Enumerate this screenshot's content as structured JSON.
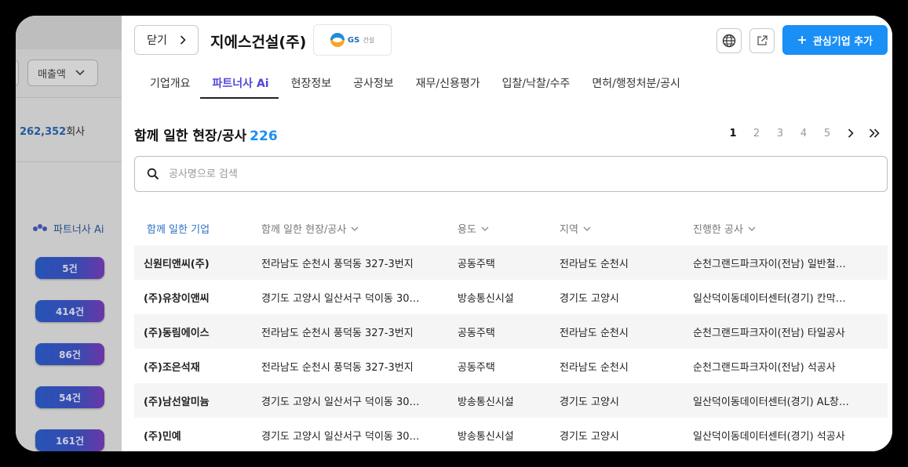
{
  "background": {
    "filter_select": "매출액",
    "company_count": "262,352",
    "company_count_suffix": "회사",
    "partner_label": "파트너사 Ai",
    "pills": [
      "5건",
      "414건",
      "86건",
      "54건",
      "161건"
    ]
  },
  "header": {
    "close_label": "닫기",
    "company_name": "지에스건설(주)",
    "logo_text": "GS",
    "logo_sub": "건설",
    "add_button_label": "관심기업 추가"
  },
  "tabs": [
    {
      "label": "기업개요",
      "active": false
    },
    {
      "label": "파트너사",
      "suffix": "Ai",
      "active": true
    },
    {
      "label": "현장정보",
      "active": false
    },
    {
      "label": "공사정보",
      "active": false
    },
    {
      "label": "재무/신용평가",
      "active": false
    },
    {
      "label": "입찰/낙찰/수주",
      "active": false
    },
    {
      "label": "면허/행정처분/공시",
      "active": false
    }
  ],
  "section": {
    "title": "함께 일한 현장/공사",
    "count": "226"
  },
  "pagination": {
    "pages": [
      "1",
      "2",
      "3",
      "4",
      "5"
    ],
    "current": "1"
  },
  "search": {
    "placeholder": "공사명으로 검색",
    "value": ""
  },
  "table": {
    "columns": [
      "함께 일한 기업",
      "함께 일한 현장/공사",
      "용도",
      "지역",
      "진행한 공사"
    ],
    "rows": [
      [
        "신원티앤씨(주)",
        "전라남도 순천시 풍덕동 327-3번지",
        "공동주택",
        "전라남도 순천시",
        "순천그랜드파크자이(전남) 일반철…"
      ],
      [
        "(주)유창이앤씨",
        "경기도 고양시 일산서구 덕이동 30…",
        "방송통신시설",
        "경기도 고양시",
        "일산덕이동데이터센터(경기) 칸막…"
      ],
      [
        "(주)동림에이스",
        "전라남도 순천시 풍덕동 327-3번지",
        "공동주택",
        "전라남도 순천시",
        "순천그랜드파크자이(전남) 타일공사"
      ],
      [
        "(주)조은석재",
        "전라남도 순천시 풍덕동 327-3번지",
        "공동주택",
        "전라남도 순천시",
        "순천그랜드파크자이(전남) 석공사"
      ],
      [
        "(주)남선알미늄",
        "경기도 고양시 일산서구 덕이동 30…",
        "방송통신시설",
        "경기도 고양시",
        "일산덕이동데이터센터(경기) AL창…"
      ],
      [
        "(주)민예",
        "경기도 고양시 일산서구 덕이동 30…",
        "방송통신시설",
        "경기도 고양시",
        "일산덕이동데이터센터(경기) 석공사"
      ]
    ]
  },
  "colors": {
    "accent": "#1a8ff5",
    "tab_active": "#5146d8",
    "column_active": "#2c6fc1"
  }
}
